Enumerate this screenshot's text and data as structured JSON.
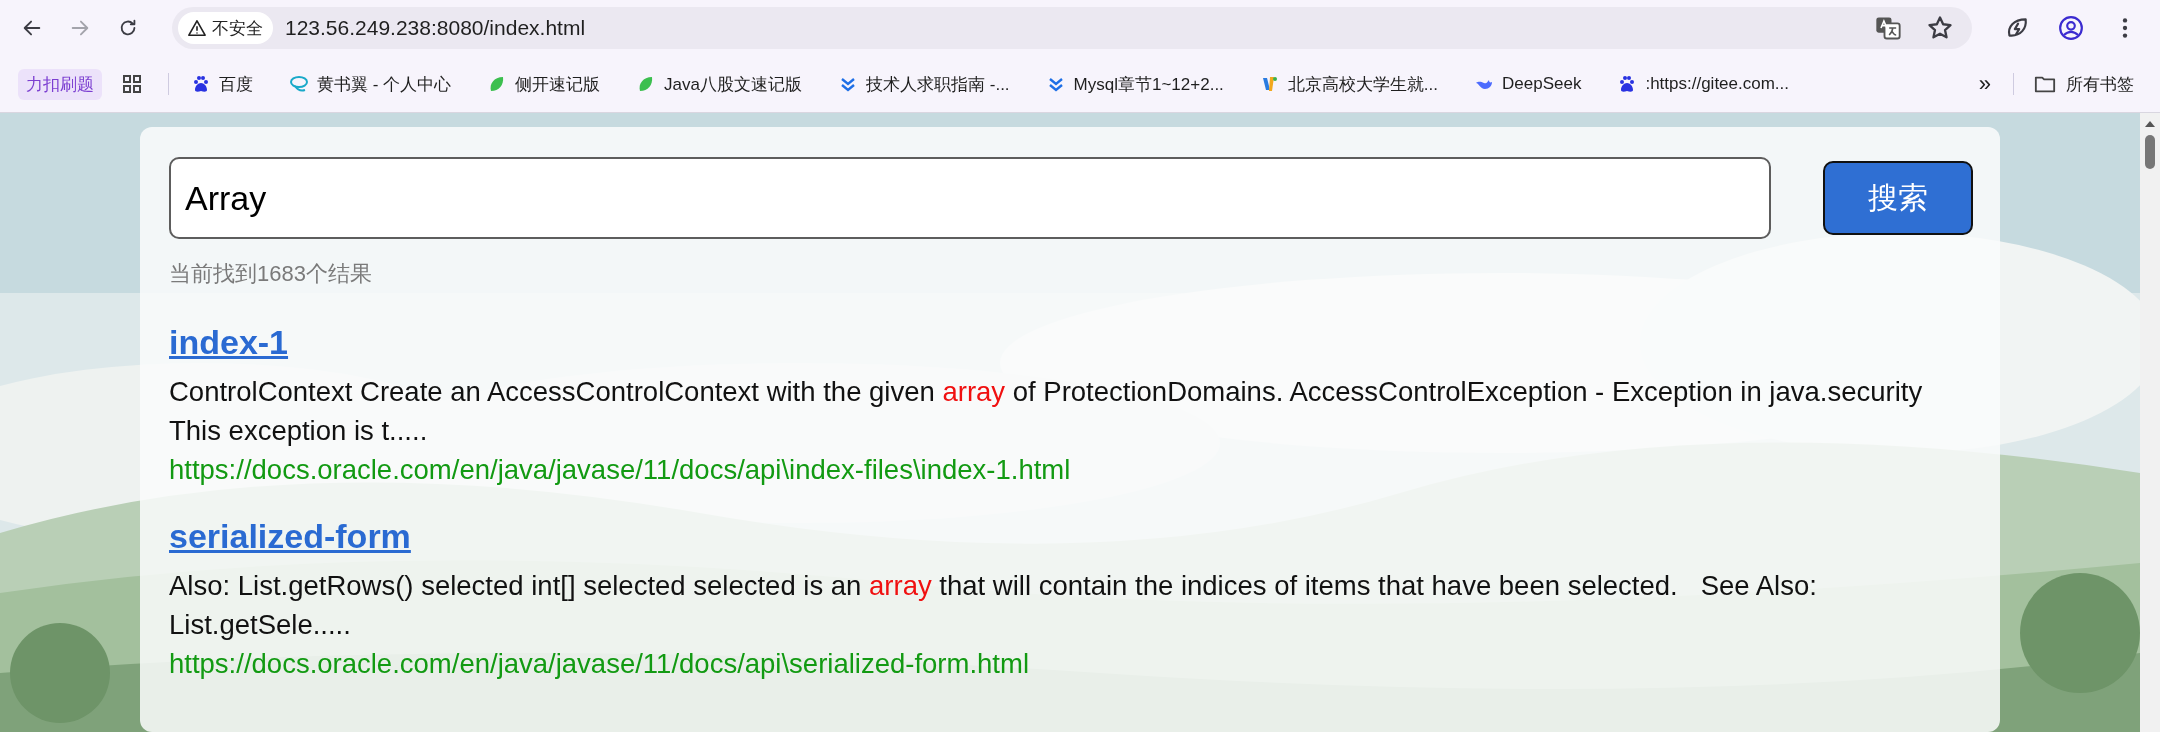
{
  "browser": {
    "back_enabled": true,
    "forward_enabled": false,
    "security_label": "不安全",
    "url": "123.56.249.238:8080/index.html"
  },
  "bookmarks": [
    {
      "kind": "chip",
      "label": "力扣刷题"
    },
    {
      "kind": "paw",
      "label": "百度"
    },
    {
      "kind": "swirl",
      "label": "黄书翼 - 个人中心"
    },
    {
      "kind": "leaf",
      "label": "侧开速记版"
    },
    {
      "kind": "leaf",
      "label": "Java八股文速记版"
    },
    {
      "kind": "chevrons",
      "label": "技术人求职指南 -..."
    },
    {
      "kind": "chevrons",
      "label": "Mysql章节1~12+2..."
    },
    {
      "kind": "campus",
      "label": "北京高校大学生就..."
    },
    {
      "kind": "whale",
      "label": "DeepSeek"
    },
    {
      "kind": "paw",
      "label": ":https://gitee.com..."
    }
  ],
  "bookmarks_more": "»",
  "all_bookmarks": "所有书签",
  "search": {
    "value": "Array",
    "button": "搜索"
  },
  "result_count": "当前找到1683个结果",
  "results": [
    {
      "title": "index-1",
      "segments": [
        {
          "text": "ControlContext Create an AccessControlContext with the given ",
          "highlight": false
        },
        {
          "text": "array",
          "highlight": true
        },
        {
          "text": " of ProtectionDomains. AccessControlException - Exception in java.security This exception is t.....",
          "highlight": false
        }
      ],
      "url": "https://docs.oracle.com/en/java/javase/11/docs/api\\index-files\\index-1.html"
    },
    {
      "title": "serialized-form",
      "segments": [
        {
          "text": "Also: List.getRows() selected int[] selected selected is an ",
          "highlight": false
        },
        {
          "text": "array",
          "highlight": true
        },
        {
          "text": " that will contain the indices of items that have been selected.   See Also: List.getSele.....",
          "highlight": false
        }
      ],
      "url": "https://docs.oracle.com/en/java/javase/11/docs/api\\serialized-form.html"
    }
  ]
}
